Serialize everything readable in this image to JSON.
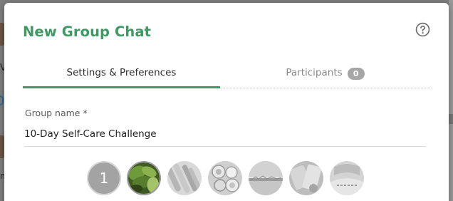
{
  "dialog": {
    "title": "New Group Chat",
    "help_icon": "question-circle-icon"
  },
  "tabs": [
    {
      "label": "Settings & Preferences",
      "active": true
    },
    {
      "label": "Participants",
      "count": "0",
      "active": false
    }
  ],
  "form": {
    "group_name_label": "Group name *",
    "group_name_value": "10-Day Self-Care Challenge"
  },
  "avatar_picker": {
    "selected_number": "1",
    "options": [
      "leaves-photo",
      "vegetables-photo",
      "bowls-photo",
      "landscape-photo",
      "food-photo",
      "fabric-photo"
    ]
  },
  "colors": {
    "accent": "#3d9a62",
    "badge": "#a6a6a6",
    "tab_inactive": "#8a8a8a"
  }
}
